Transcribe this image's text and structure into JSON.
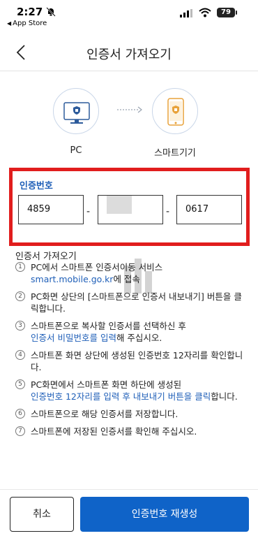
{
  "status_bar": {
    "time": "2:27",
    "back_app": "App Store",
    "battery": "79"
  },
  "nav": {
    "title": "인증서 가져오기"
  },
  "diagram": {
    "pc_label": "PC",
    "phone_label": "스마트기기"
  },
  "auth": {
    "title": "인증번호",
    "code_part1": "4859",
    "code_part2": "",
    "code_part3": "0617",
    "separator": "-"
  },
  "guide": {
    "title": "인증서 가져오기",
    "steps": [
      {
        "num": "1",
        "text": "PC에서 스마트폰 인증서이동 서비스",
        "link": "smart.mobile.go.kr",
        "tail": "에 접속"
      },
      {
        "num": "2",
        "text": "PC화면 상단의 [스마트폰으로 인증서 내보내기] 버튼을 클릭합니다."
      },
      {
        "num": "3",
        "text": "스마트폰으로 복사할 인증서를 선택하신 후",
        "link": "인증서 비밀번호를 입력",
        "tail": "해 주십시오."
      },
      {
        "num": "4",
        "text": "스마트폰 화면 상단에 생성된 인증번호 12자리를 확인합니다."
      },
      {
        "num": "5",
        "text": "PC화면에서 스마트폰 화면 하단에 생성된",
        "link": "인증번호 12자리를 입력 후 내보내기 버튼을 클릭",
        "tail": "합니다."
      },
      {
        "num": "6",
        "text": "스마트폰으로 해당 인증서를 저장합니다."
      },
      {
        "num": "7",
        "text": "스마트폰에 저장된 인증서를 확인해 주십시오."
      }
    ]
  },
  "buttons": {
    "cancel": "취소",
    "regenerate": "인증번호 재생성"
  },
  "colors": {
    "accent": "#0f63c8",
    "highlight_border": "#e11d1d",
    "link": "#1f5fb8"
  }
}
